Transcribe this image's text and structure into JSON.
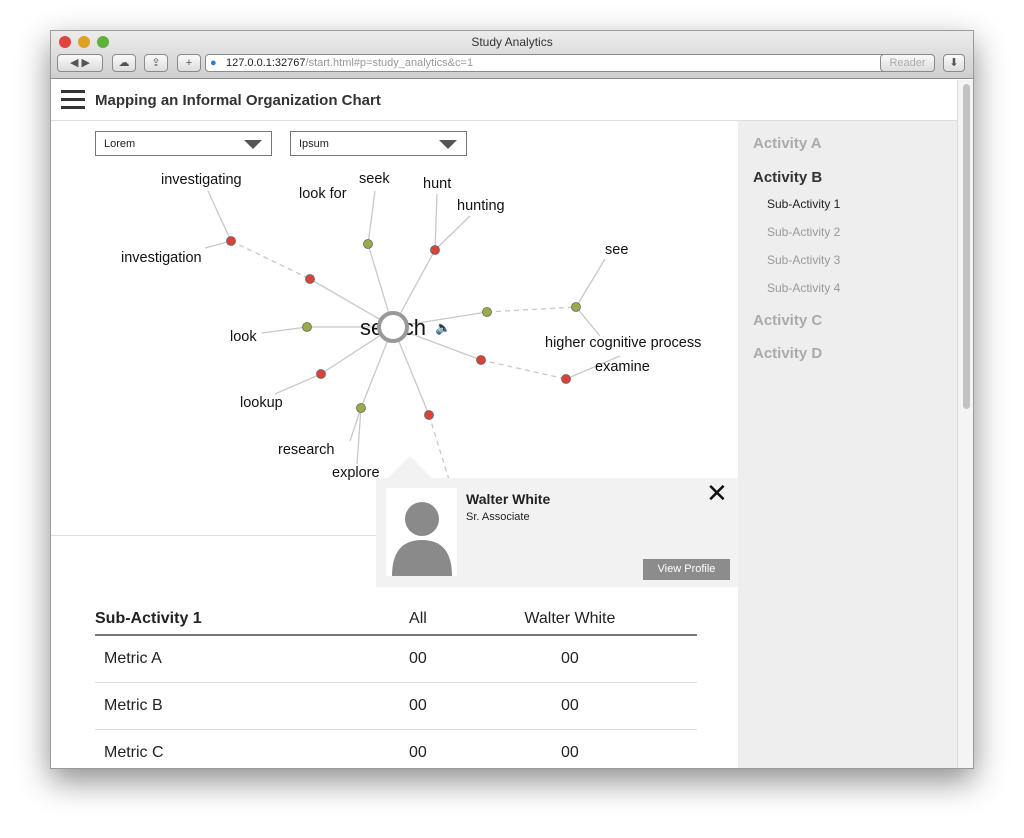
{
  "window": {
    "title": "Study Analytics",
    "url_host": "127.0.0.1:32767",
    "url_path": "/start.html#p=study_analytics&c=1",
    "reader": "Reader"
  },
  "header": {
    "title": "Mapping an Informal Organization Chart"
  },
  "filters": [
    {
      "value": "Lorem"
    },
    {
      "value": "Ipsum"
    }
  ],
  "graph": {
    "center": "search",
    "colors": {
      "red": "#d9423a",
      "green": "#9aab4a",
      "edge": "#c8c8c8"
    },
    "labels": [
      "investigating",
      "investigation",
      "look for",
      "seek",
      "hunt",
      "hunting",
      "see",
      "higher cognitive process",
      "examine",
      "look",
      "lookup",
      "research",
      "explore"
    ]
  },
  "popup": {
    "name": "Walter White",
    "role": "Sr. Associate",
    "button": "View Profile"
  },
  "sidebar": {
    "activities": [
      {
        "label": "Activity A"
      },
      {
        "label": "Activity B",
        "subs": [
          "Sub-Activity 1",
          "Sub-Activity 2",
          "Sub-Activity 3",
          "Sub-Activity 4"
        ]
      },
      {
        "label": "Activity C"
      },
      {
        "label": "Activity D"
      }
    ]
  },
  "table": {
    "headers": [
      "Sub-Activity 1",
      "All",
      "Walter White"
    ],
    "rows": [
      [
        "Metric A",
        "00",
        "00"
      ],
      [
        "Metric B",
        "00",
        "00"
      ],
      [
        "Metric C",
        "00",
        "00"
      ]
    ]
  }
}
